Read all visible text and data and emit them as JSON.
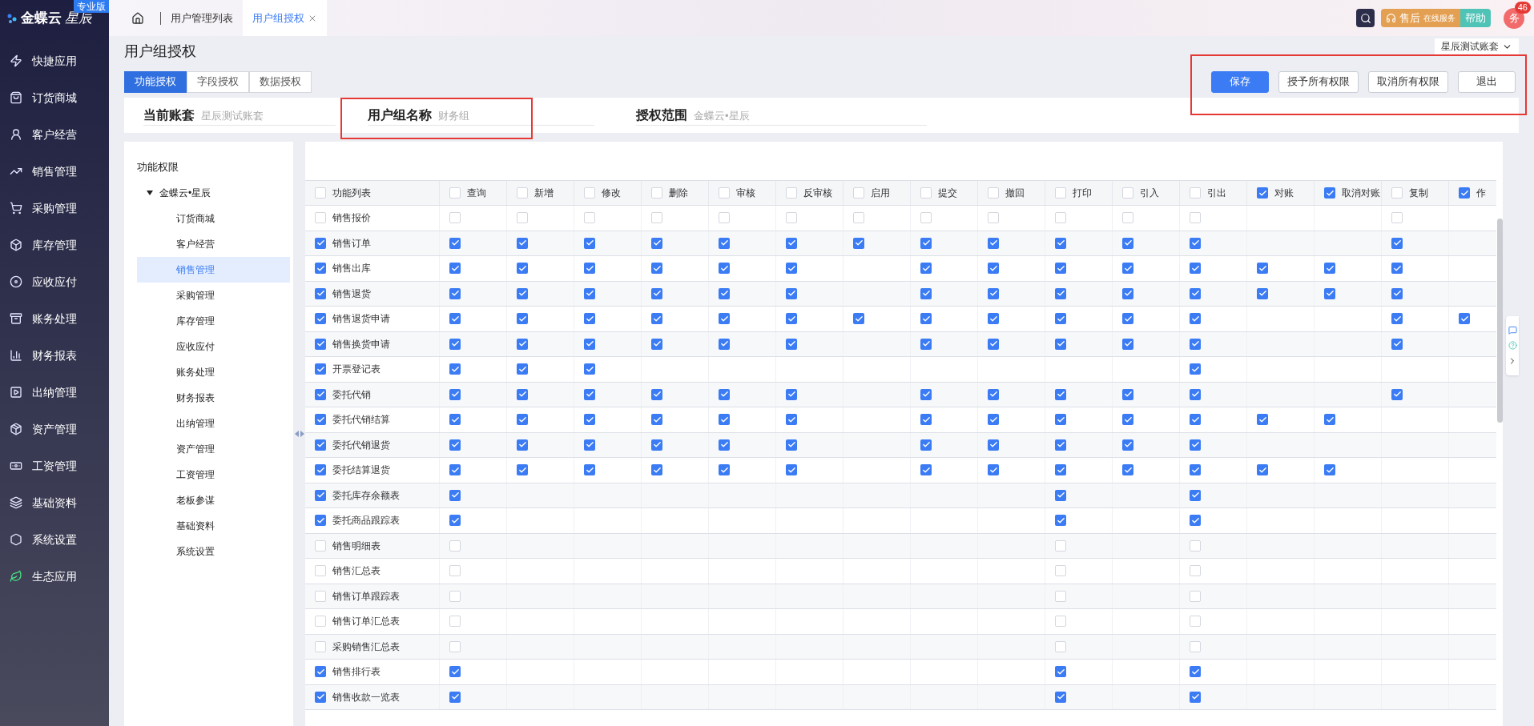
{
  "sidebar": {
    "brand_name": "金蝶云",
    "brand_product": "星辰",
    "edition": "专业版",
    "items": [
      {
        "label": "快捷应用"
      },
      {
        "label": "订货商城"
      },
      {
        "label": "客户经营"
      },
      {
        "label": "销售管理"
      },
      {
        "label": "采购管理"
      },
      {
        "label": "库存管理"
      },
      {
        "label": "应收应付"
      },
      {
        "label": "账务处理"
      },
      {
        "label": "财务报表"
      },
      {
        "label": "出纳管理"
      },
      {
        "label": "资产管理"
      },
      {
        "label": "工资管理"
      },
      {
        "label": "基础资料"
      },
      {
        "label": "系统设置"
      },
      {
        "label": "生态应用"
      }
    ]
  },
  "top_tabs": [
    {
      "label": "用户管理列表",
      "selected": false,
      "closable": false
    },
    {
      "label": "用户组授权",
      "selected": true,
      "closable": true
    }
  ],
  "top_actions": {
    "service_label": "售后",
    "service_sub": "在线服务",
    "help_label": "帮助",
    "avatar": "务",
    "badge": "46"
  },
  "page": {
    "title": "用户组授权",
    "account_selector": "星辰测试账套"
  },
  "mode_tabs": [
    {
      "label": "功能授权",
      "selected": true
    },
    {
      "label": "字段授权",
      "selected": false
    },
    {
      "label": "数据授权",
      "selected": false
    }
  ],
  "buttons": [
    {
      "label": "保存",
      "kind": "primary"
    },
    {
      "label": "授予所有权限",
      "kind": "default"
    },
    {
      "label": "取消所有权限",
      "kind": "default"
    },
    {
      "label": "退出",
      "kind": "default"
    }
  ],
  "info": [
    {
      "label": "当前账套",
      "value": "星辰测试账套"
    },
    {
      "label": "用户组名称",
      "value": "财务组"
    },
    {
      "label": "授权范围",
      "value": "金蝶云•星辰"
    }
  ],
  "tree": {
    "title": "功能权限",
    "root": {
      "label": "金蝶云•星辰",
      "expanded": true,
      "children": [
        {
          "label": "订货商城",
          "selected": false
        },
        {
          "label": "客户经营",
          "selected": false
        },
        {
          "label": "销售管理",
          "selected": true
        },
        {
          "label": "采购管理",
          "selected": false
        },
        {
          "label": "库存管理",
          "selected": false
        },
        {
          "label": "应收应付",
          "selected": false
        },
        {
          "label": "账务处理",
          "selected": false
        },
        {
          "label": "财务报表",
          "selected": false
        },
        {
          "label": "出纳管理",
          "selected": false
        },
        {
          "label": "资产管理",
          "selected": false
        },
        {
          "label": "工资管理",
          "selected": false
        },
        {
          "label": "老板参谋",
          "selected": false
        },
        {
          "label": "基础资料",
          "selected": false
        },
        {
          "label": "系统设置",
          "selected": false
        }
      ]
    }
  },
  "table": {
    "first_column": {
      "label": "功能列表",
      "checked": false
    },
    "columns": [
      {
        "label": "查询",
        "checked": false
      },
      {
        "label": "新增",
        "checked": false
      },
      {
        "label": "修改",
        "checked": false
      },
      {
        "label": "删除",
        "checked": false
      },
      {
        "label": "审核",
        "checked": false
      },
      {
        "label": "反审核",
        "checked": false
      },
      {
        "label": "启用",
        "checked": false
      },
      {
        "label": "提交",
        "checked": false
      },
      {
        "label": "撤回",
        "checked": false
      },
      {
        "label": "打印",
        "checked": false
      },
      {
        "label": "引入",
        "checked": false
      },
      {
        "label": "引出",
        "checked": false
      },
      {
        "label": "对账",
        "checked": true
      },
      {
        "label": "取消对账",
        "checked": true
      },
      {
        "label": "复制",
        "checked": false
      },
      {
        "label": "作",
        "checked": true
      }
    ],
    "rows": [
      {
        "label": "销售报价",
        "checked": false,
        "cells": [
          false,
          false,
          false,
          false,
          false,
          false,
          false,
          false,
          false,
          false,
          false,
          false,
          null,
          null,
          false,
          null
        ]
      },
      {
        "label": "销售订单",
        "checked": true,
        "cells": [
          true,
          true,
          true,
          true,
          true,
          true,
          true,
          true,
          true,
          true,
          true,
          true,
          null,
          null,
          true,
          null
        ]
      },
      {
        "label": "销售出库",
        "checked": true,
        "cells": [
          true,
          true,
          true,
          true,
          true,
          true,
          null,
          true,
          true,
          true,
          true,
          true,
          true,
          true,
          true,
          null
        ]
      },
      {
        "label": "销售退货",
        "checked": true,
        "cells": [
          true,
          true,
          true,
          true,
          true,
          true,
          null,
          true,
          true,
          true,
          true,
          true,
          true,
          true,
          true,
          null
        ]
      },
      {
        "label": "销售退货申请",
        "checked": true,
        "cells": [
          true,
          true,
          true,
          true,
          true,
          true,
          true,
          true,
          true,
          true,
          true,
          true,
          null,
          null,
          true,
          true
        ]
      },
      {
        "label": "销售换货申请",
        "checked": true,
        "cells": [
          true,
          true,
          true,
          true,
          true,
          true,
          null,
          true,
          true,
          true,
          true,
          true,
          null,
          null,
          true,
          null
        ]
      },
      {
        "label": "开票登记表",
        "checked": true,
        "cells": [
          true,
          true,
          true,
          null,
          null,
          null,
          null,
          null,
          null,
          null,
          null,
          true,
          null,
          null,
          null,
          null
        ]
      },
      {
        "label": "委托代销",
        "checked": true,
        "cells": [
          true,
          true,
          true,
          true,
          true,
          true,
          null,
          true,
          true,
          true,
          true,
          true,
          null,
          null,
          true,
          null
        ]
      },
      {
        "label": "委托代销结算",
        "checked": true,
        "cells": [
          true,
          true,
          true,
          true,
          true,
          true,
          null,
          true,
          true,
          true,
          true,
          true,
          true,
          true,
          null,
          null
        ]
      },
      {
        "label": "委托代销退货",
        "checked": true,
        "cells": [
          true,
          true,
          true,
          true,
          true,
          true,
          null,
          true,
          true,
          true,
          true,
          true,
          null,
          null,
          null,
          null
        ]
      },
      {
        "label": "委托结算退货",
        "checked": true,
        "cells": [
          true,
          true,
          true,
          true,
          true,
          true,
          null,
          true,
          true,
          true,
          true,
          true,
          true,
          true,
          null,
          null
        ]
      },
      {
        "label": "委托库存余额表",
        "checked": true,
        "cells": [
          true,
          null,
          null,
          null,
          null,
          null,
          null,
          null,
          null,
          true,
          null,
          true,
          null,
          null,
          null,
          null
        ]
      },
      {
        "label": "委托商品跟踪表",
        "checked": true,
        "cells": [
          true,
          null,
          null,
          null,
          null,
          null,
          null,
          null,
          null,
          true,
          null,
          true,
          null,
          null,
          null,
          null
        ]
      },
      {
        "label": "销售明细表",
        "checked": false,
        "cells": [
          false,
          null,
          null,
          null,
          null,
          null,
          null,
          null,
          null,
          false,
          null,
          false,
          null,
          null,
          null,
          null
        ]
      },
      {
        "label": "销售汇总表",
        "checked": false,
        "cells": [
          false,
          null,
          null,
          null,
          null,
          null,
          null,
          null,
          null,
          false,
          null,
          false,
          null,
          null,
          null,
          null
        ]
      },
      {
        "label": "销售订单跟踪表",
        "checked": false,
        "cells": [
          false,
          null,
          null,
          null,
          null,
          null,
          null,
          null,
          null,
          false,
          null,
          false,
          null,
          null,
          null,
          null
        ]
      },
      {
        "label": "销售订单汇总表",
        "checked": false,
        "cells": [
          false,
          null,
          null,
          null,
          null,
          null,
          null,
          null,
          null,
          false,
          null,
          false,
          null,
          null,
          null,
          null
        ]
      },
      {
        "label": "采购销售汇总表",
        "checked": false,
        "cells": [
          false,
          null,
          null,
          null,
          null,
          null,
          null,
          null,
          null,
          false,
          null,
          false,
          null,
          null,
          null,
          null
        ]
      },
      {
        "label": "销售排行表",
        "checked": true,
        "cells": [
          true,
          null,
          null,
          null,
          null,
          null,
          null,
          null,
          null,
          true,
          null,
          true,
          null,
          null,
          null,
          null
        ]
      },
      {
        "label": "销售收款一览表",
        "checked": true,
        "cells": [
          true,
          null,
          null,
          null,
          null,
          null,
          null,
          null,
          null,
          true,
          null,
          true,
          null,
          null,
          null,
          null
        ]
      }
    ]
  }
}
